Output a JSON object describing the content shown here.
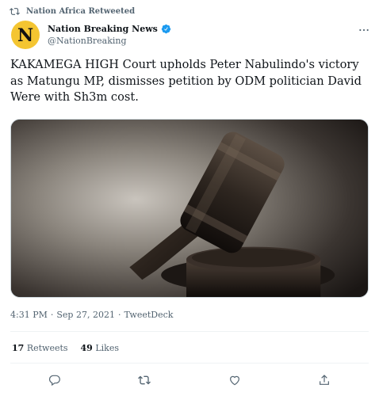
{
  "retweet": {
    "text": "Nation Africa Retweeted",
    "icon": "retweet-icon"
  },
  "author": {
    "avatar_letter": "N",
    "avatar_color": "#f4c531",
    "name": "Nation Breaking News",
    "handle": "@NationBreaking",
    "verified": true,
    "verified_color": "#1d9bf0"
  },
  "tweet": {
    "text": "KAKAMEGA HIGH Court upholds Peter Nabulindo's victory as Matungu MP, dismisses petition by ODM politician David Were with Sh3m cost.",
    "image_description_icon": "gavel-image"
  },
  "meta": {
    "time": "4:31 PM",
    "sep1": "·",
    "date": "Sep 27, 2021",
    "sep2": "·",
    "source": "TweetDeck"
  },
  "stats": {
    "retweets_count": "17",
    "retweets_label": "Retweets",
    "likes_count": "49",
    "likes_label": "Likes"
  },
  "actions": [
    "reply-icon",
    "retweet-icon",
    "like-icon",
    "share-icon"
  ],
  "colors": {
    "secondary_text": "#536471",
    "primary_text": "#0f1419",
    "divider": "#eff3f4"
  }
}
